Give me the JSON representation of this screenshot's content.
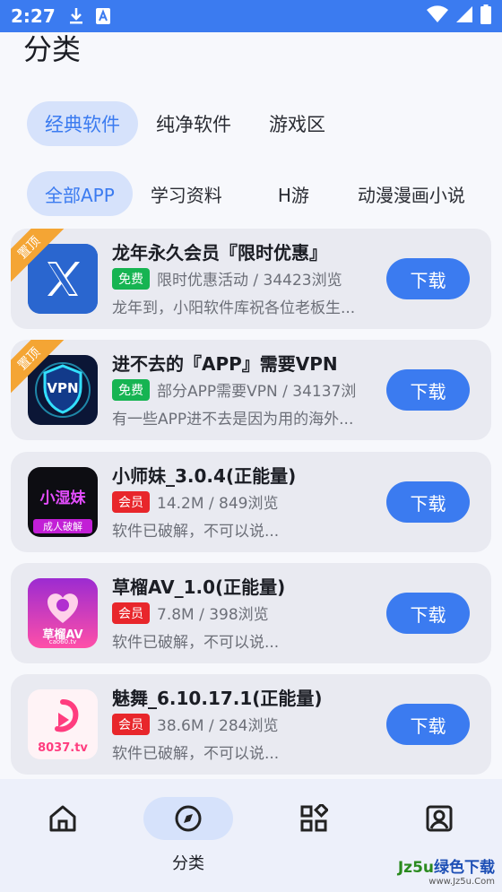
{
  "status_bar": {
    "time": "2:27"
  },
  "page_title": "分类",
  "category_tabs": [
    {
      "label": "经典软件",
      "active": true
    },
    {
      "label": "纯净软件",
      "active": false
    },
    {
      "label": "游戏区",
      "active": false
    }
  ],
  "sub_tabs": [
    {
      "label": "全部APP",
      "active": true
    },
    {
      "label": "学习资料",
      "active": false
    },
    {
      "label": "H游",
      "active": false
    },
    {
      "label": "动漫漫画小说",
      "active": false
    }
  ],
  "apps": [
    {
      "title": "龙年永久会员『限时优惠』",
      "badge": "免费",
      "badge_type": "free",
      "meta": "限时优惠活动 / 34423浏览",
      "desc": "龙年到，小阳软件库祝各位老板生...",
      "pinned": true,
      "pin_label": "置顶",
      "icon": "x-logo-icon",
      "button": "下载"
    },
    {
      "title": "进不去的『APP』需要VPN",
      "badge": "免费",
      "badge_type": "free",
      "meta": "部分APP需要VPN / 34137浏",
      "desc": "有一些APP进不去是因为用的海外...",
      "pinned": true,
      "pin_label": "置顶",
      "icon": "vpn-shield-icon",
      "icon_text": "VPN",
      "button": "下载"
    },
    {
      "title": "小师妹_3.0.4(正能量)",
      "badge": "会员",
      "badge_type": "vip",
      "meta": "14.2M / 849浏览",
      "desc": "软件已破解，不可以说...",
      "pinned": false,
      "icon": "app-icon-xiaoshimei",
      "icon_text": "小湿妹",
      "icon_sub": "成人破解",
      "button": "下载"
    },
    {
      "title": "草榴AV_1.0(正能量)",
      "badge": "会员",
      "badge_type": "vip",
      "meta": "7.8M / 398浏览",
      "desc": "软件已破解，不可以说...",
      "pinned": false,
      "icon": "app-icon-caoliu",
      "icon_text": "草榴AV",
      "icon_sub": "cao60.tv",
      "button": "下载"
    },
    {
      "title": "魅舞_6.10.17.1(正能量)",
      "badge": "会员",
      "badge_type": "vip",
      "meta": "38.6M / 284浏览",
      "desc": "软件已破解，不可以说...",
      "pinned": false,
      "icon": "app-icon-meiwu",
      "icon_text": "8037.tv",
      "button": "下载"
    }
  ],
  "bottom_nav": [
    {
      "label": "",
      "icon": "home-icon",
      "active": false
    },
    {
      "label": "分类",
      "icon": "compass-icon",
      "active": true
    },
    {
      "label": "",
      "icon": "apps-grid-icon",
      "active": false
    },
    {
      "label": "",
      "icon": "profile-icon",
      "active": false
    }
  ],
  "watermark": {
    "main_green": "Jz5u",
    "main_blue": "绿色下载",
    "sub": "www.Jz5u.Com"
  },
  "colors": {
    "accent": "#3b7bf0",
    "free": "#16b452",
    "vip": "#e8262b",
    "pin": "#f4a534"
  }
}
